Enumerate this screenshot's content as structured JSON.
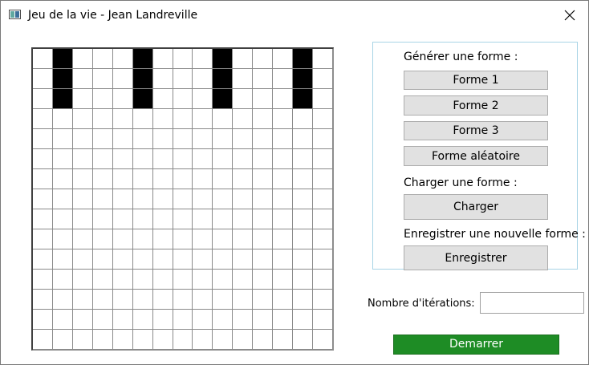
{
  "window": {
    "title": "Jeu de la vie - Jean Landreville"
  },
  "grid": {
    "rows": 15,
    "cols": 15,
    "alive_cells": [
      [
        0,
        1
      ],
      [
        1,
        1
      ],
      [
        2,
        1
      ],
      [
        0,
        5
      ],
      [
        1,
        5
      ],
      [
        2,
        5
      ],
      [
        0,
        9
      ],
      [
        1,
        9
      ],
      [
        2,
        9
      ],
      [
        0,
        13
      ],
      [
        1,
        13
      ],
      [
        2,
        13
      ]
    ]
  },
  "generate": {
    "label": "Générer une forme :",
    "buttons": [
      "Forme 1",
      "Forme 2",
      "Forme 3",
      "Forme aléatoire"
    ]
  },
  "load": {
    "label": "Charger une forme :",
    "button": "Charger"
  },
  "save": {
    "label": "Enregistrer une nouvelle forme :",
    "button": "Enregistrer"
  },
  "iterations": {
    "label": "Nombre d'itérations:",
    "value": ""
  },
  "start": {
    "label": "Demarrer",
    "color": "#1e8c25"
  },
  "icons": {
    "close": "close-icon",
    "app": "app-window-icon"
  }
}
